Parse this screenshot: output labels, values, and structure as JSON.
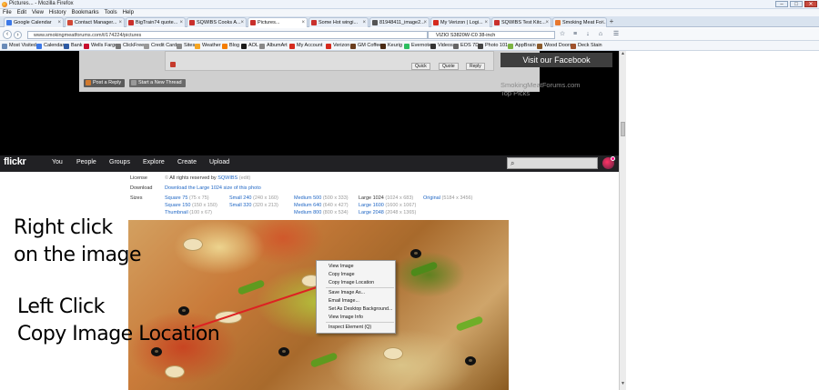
{
  "window": {
    "title": "Pictures... - Mozilla Firefox"
  },
  "menu": [
    "File",
    "Edit",
    "View",
    "History",
    "Bookmarks",
    "Tools",
    "Help"
  ],
  "tabs": [
    {
      "label": "Google Calendar",
      "color": "#3b78e7"
    },
    {
      "label": "Contact Manager...",
      "color": "#d14836"
    },
    {
      "label": "BigTrain74 quote...",
      "color": "#c9302c"
    },
    {
      "label": "SQWIBS Cooks A...",
      "color": "#c9302c"
    },
    {
      "label": "Pictures...",
      "color": "#c9302c",
      "active": true
    },
    {
      "label": "Some Hot wingi...",
      "color": "#c9302c"
    },
    {
      "label": "81948411_image2...",
      "color": "#555555"
    },
    {
      "label": "My Verizon | Logi...",
      "color": "#d52b1e"
    },
    {
      "label": "SQWIBS Test Kitc...",
      "color": "#c9302c"
    },
    {
      "label": "Smoking Meat Fo...",
      "color": "#e8782e"
    }
  ],
  "nav": {
    "url": "www.smokingmeatforums.com/t/174224/pictures",
    "search": "VIZIO S3820W-C0 38-inch"
  },
  "bookmarks": [
    {
      "label": "Most Visited",
      "color": "#6a8bb8"
    },
    {
      "label": "Calendar",
      "color": "#3b78e7"
    },
    {
      "label": "Bank",
      "color": "#2d5aa3"
    },
    {
      "label": "Wells Fargo",
      "color": "#c8102e"
    },
    {
      "label": "ClickFree",
      "color": "#777777"
    },
    {
      "label": "Credit Card",
      "color": "#999999"
    },
    {
      "label": "Sites",
      "color": "#8a8a8a"
    },
    {
      "label": "Weather",
      "color": "#f5a623"
    },
    {
      "label": "Blog",
      "color": "#f57d00"
    },
    {
      "label": "AOL",
      "color": "#1a1a1a"
    },
    {
      "label": "AlbumArt",
      "color": "#888888"
    },
    {
      "label": "My Account",
      "color": "#d52b1e"
    },
    {
      "label": "Verizon",
      "color": "#d52b1e"
    },
    {
      "label": "GM Coffee",
      "color": "#6b3e1e"
    },
    {
      "label": "Keurig",
      "color": "#4a2a14"
    },
    {
      "label": "Evernote",
      "color": "#2dbe60"
    },
    {
      "label": "Videos",
      "color": "#333333"
    },
    {
      "label": "EOS 7D",
      "color": "#666666"
    },
    {
      "label": "Photo 101",
      "color": "#444444"
    },
    {
      "label": "AppBrain",
      "color": "#7cb342"
    },
    {
      "label": "Wood Doors",
      "color": "#8b5a2b"
    },
    {
      "label": "Deck Stain",
      "color": "#a0522d"
    }
  ],
  "forum": {
    "quick": "Quick",
    "quote": "Quote",
    "reply": "Reply",
    "post_reply": "Post a Reply",
    "new_thread": "Start a New Thread",
    "visit_fb": "Visit our Facebook",
    "top_picks": "SmokingMeatForums.com Top Picks"
  },
  "flickr": {
    "logo": "flickr",
    "nav": [
      "You",
      "People",
      "Groups",
      "Explore",
      "Create",
      "Upload"
    ]
  },
  "photo_info": {
    "license_label": "License",
    "license_text": "All rights reserved by",
    "license_owner": "SQWIBS",
    "license_edit": "(edit)",
    "download_label": "Download",
    "download_link": "Download the Large 1024 size of this photo",
    "sizes_label": "Sizes",
    "sizes": [
      {
        "name": "Square 75",
        "dim": "(75 x 75)"
      },
      {
        "name": "Square 150",
        "dim": "(150 x 150)"
      },
      {
        "name": "Thumbnail",
        "dim": "(100 x 67)"
      },
      {
        "name": "Small 240",
        "dim": "(240 x 160)"
      },
      {
        "name": "Small 320",
        "dim": "(320 x 213)"
      },
      {
        "name": "Medium 500",
        "dim": "(500 x 333)"
      },
      {
        "name": "Medium 640",
        "dim": "(640 x 427)"
      },
      {
        "name": "Medium 800",
        "dim": "(800 x 534)"
      },
      {
        "name": "Large 1024",
        "dim": "(1024 x 683)"
      },
      {
        "name": "Large 1600",
        "dim": "(1600 x 1067)"
      },
      {
        "name": "Large 2048",
        "dim": "(2048 x 1365)"
      },
      {
        "name": "Original",
        "dim": "(5184 x 3456)"
      }
    ]
  },
  "annotations": {
    "line1": "Right click",
    "line2": "on the image",
    "line3": "Left Click",
    "line4": "Copy Image Location"
  },
  "context_menu": [
    "View Image",
    "Copy Image",
    "Copy Image Location",
    "Save Image As...",
    "Email Image...",
    "Set As Desktop Background...",
    "View Image Info",
    "Inspect Element (Q)"
  ]
}
